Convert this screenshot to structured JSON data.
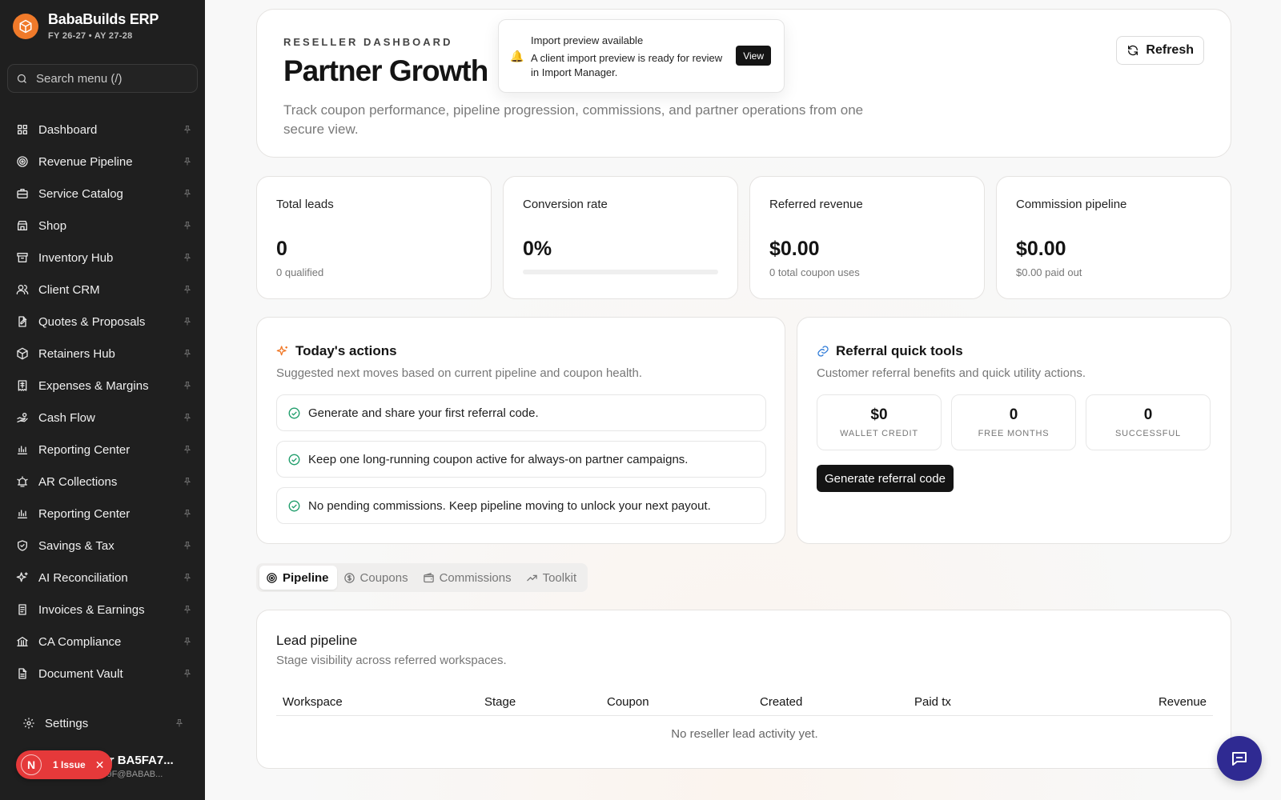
{
  "brand": {
    "title": "BabaBuilds ERP",
    "subtitle": "FY 26-27 • AY 27-28"
  },
  "search": {
    "placeholder": "Search menu (/)"
  },
  "nav": [
    {
      "label": "Dashboard",
      "icon": "grid-icon"
    },
    {
      "label": "Revenue Pipeline",
      "icon": "target-icon"
    },
    {
      "label": "Service Catalog",
      "icon": "briefcase-icon"
    },
    {
      "label": "Shop",
      "icon": "store-icon"
    },
    {
      "label": "Inventory Hub",
      "icon": "archive-icon"
    },
    {
      "label": "Client CRM",
      "icon": "users-icon"
    },
    {
      "label": "Quotes & Proposals",
      "icon": "file-edit-icon"
    },
    {
      "label": "Retainers Hub",
      "icon": "package-icon"
    },
    {
      "label": "Expenses & Margins",
      "icon": "receipt-icon"
    },
    {
      "label": "Cash Flow",
      "icon": "hand-coins-icon"
    },
    {
      "label": "Reporting Center",
      "icon": "bar-chart-icon"
    },
    {
      "label": "AR Collections",
      "icon": "alarm-icon"
    },
    {
      "label": "Reporting Center",
      "icon": "bar-chart-icon"
    },
    {
      "label": "Savings & Tax",
      "icon": "shield-icon"
    },
    {
      "label": "AI Reconciliation",
      "icon": "sparkles-icon"
    },
    {
      "label": "Invoices & Earnings",
      "icon": "invoice-icon"
    },
    {
      "label": "CA Compliance",
      "icon": "landmark-icon"
    },
    {
      "label": "Document Vault",
      "icon": "document-icon"
    }
  ],
  "settings": {
    "label": "Settings"
  },
  "user": {
    "name": "ser BA5FA7...",
    "email": "A79F@BABAB..."
  },
  "issue": {
    "avatar": "N",
    "text": "1 Issue"
  },
  "hero": {
    "eyebrow": "RESELLER DASHBOARD",
    "title": "Partner Growth",
    "description": "Track coupon performance, pipeline progression, commissions, and partner operations from one secure view.",
    "refresh_label": "Refresh"
  },
  "toast": {
    "title": "Import preview available",
    "body": "A client import preview is ready for review in Import Manager.",
    "action": "View"
  },
  "stats": [
    {
      "label": "Total leads",
      "value": "0",
      "sub": "0 qualified"
    },
    {
      "label": "Conversion rate",
      "value": "0%",
      "progress": 0
    },
    {
      "label": "Referred revenue",
      "value": "$0.00",
      "sub": "0 total coupon uses"
    },
    {
      "label": "Commission pipeline",
      "value": "$0.00",
      "sub": "$0.00 paid out"
    }
  ],
  "actions": {
    "title": "Today's actions",
    "description": "Suggested next moves based on current pipeline and coupon health.",
    "items": [
      "Generate and share your first referral code.",
      "Keep one long-running coupon active for always-on partner campaigns.",
      "No pending commissions. Keep pipeline moving to unlock your next payout."
    ]
  },
  "referral": {
    "title": "Referral quick tools",
    "description": "Customer referral benefits and quick utility actions.",
    "tiles": [
      {
        "value": "$0",
        "label": "WALLET CREDIT"
      },
      {
        "value": "0",
        "label": "FREE MONTHS"
      },
      {
        "value": "0",
        "label": "SUCCESSFUL"
      }
    ],
    "button": "Generate referral code"
  },
  "tabs": [
    {
      "label": "Pipeline",
      "active": true
    },
    {
      "label": "Coupons",
      "active": false
    },
    {
      "label": "Commissions",
      "active": false
    },
    {
      "label": "Toolkit",
      "active": false
    }
  ],
  "pipeline": {
    "title": "Lead pipeline",
    "description": "Stage visibility across referred workspaces.",
    "columns": [
      "Workspace",
      "Stage",
      "Coupon",
      "Created",
      "Paid tx",
      "Revenue"
    ],
    "empty": "No reseller lead activity yet."
  },
  "colors": {
    "accent": "#f07a2a",
    "sidebar": "#1f1f1f",
    "chat": "#2f2a92",
    "issue": "#e5393a",
    "success": "#1f9d6b"
  }
}
